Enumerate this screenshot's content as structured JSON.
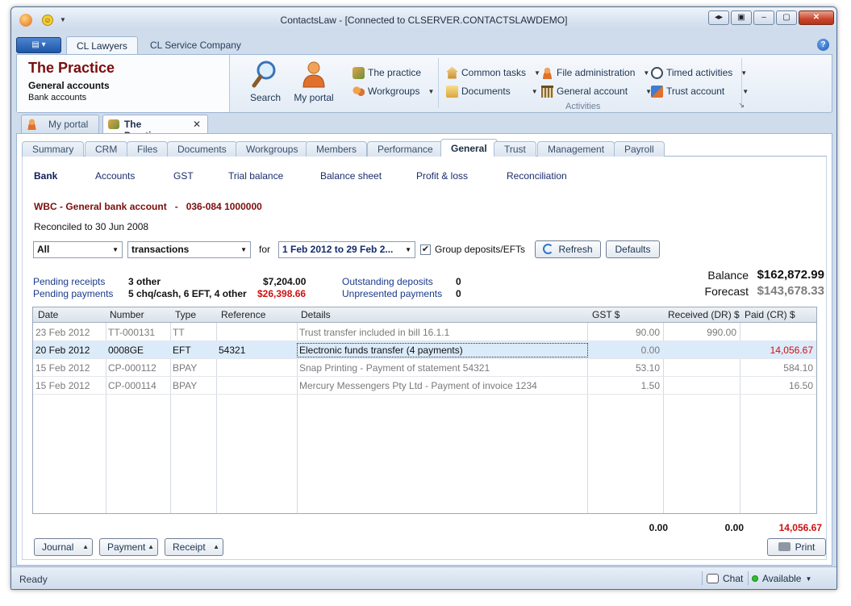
{
  "window": {
    "title": "ContactsLaw - [Connected to CLSERVER.CONTACTSLAWDEMO]"
  },
  "ribbon": {
    "tabs": [
      "CL Lawyers",
      "CL Service Company"
    ],
    "context": {
      "title": "The Practice",
      "subtitle": "General accounts",
      "subtitle2": "Bank accounts"
    },
    "buttons": {
      "search": "Search",
      "my_portal": "My portal",
      "the_practice": "The practice",
      "workgroups": "Workgroups",
      "common_tasks": "Common tasks",
      "documents": "Documents",
      "file_administration": "File administration",
      "general_account": "General account",
      "timed_activities": "Timed activities",
      "trust_account": "Trust account"
    },
    "group_label": "Activities"
  },
  "doc_tabs": [
    "My portal",
    "The Practice"
  ],
  "sub_tabs": [
    "Summary",
    "CRM",
    "Files",
    "Documents",
    "Workgroups",
    "Members",
    "Performance",
    "General",
    "Trust",
    "Management",
    "Payroll"
  ],
  "active_sub_tab": "General",
  "links": [
    "Bank",
    "Accounts",
    "GST",
    "Trial balance",
    "Balance sheet",
    "Profit & loss",
    "Reconciliation"
  ],
  "account": {
    "title": "WBC - General bank account   -   036-084 1000000",
    "reconciled": "Reconciled to 30 Jun 2008"
  },
  "filters": {
    "scope": "All",
    "kind": "transactions",
    "for_label": "for",
    "date_range": "1 Feb 2012 to 29 Feb 2...",
    "group_check_label": "Group deposits/EFTs",
    "group_checked": true,
    "refresh": "Refresh",
    "defaults": "Defaults"
  },
  "pending": {
    "receipts_label": "Pending receipts",
    "receipts_count": "3 other",
    "receipts_amount": "$7,204.00",
    "payments_label": "Pending payments",
    "payments_count": "5 chq/cash, 6 EFT, 4 other",
    "payments_amount": "$26,398.66",
    "outstanding_label": "Outstanding deposits",
    "outstanding_value": "0",
    "unpresented_label": "Unpresented payments",
    "unpresented_value": "0"
  },
  "balance": {
    "balance_label": "Balance",
    "balance_value": "$162,872.99",
    "forecast_label": "Forecast",
    "forecast_value": "$143,678.33"
  },
  "table": {
    "columns": [
      "Date",
      "Number",
      "Type",
      "Reference",
      "Details",
      "GST $",
      "Received (DR) $",
      "Paid (CR) $"
    ],
    "rows": [
      {
        "date": "23 Feb 2012",
        "number": "TT-000131",
        "type": "TT",
        "reference": "",
        "details": "Trust transfer included in bill 16.1.1",
        "gst": "90.00",
        "received": "990.00",
        "paid": ""
      },
      {
        "date": "20 Feb 2012",
        "number": "0008GE",
        "type": "EFT",
        "reference": "54321",
        "details": "Electronic funds transfer (4 payments)",
        "gst": "0.00",
        "received": "",
        "paid": "14,056.67"
      },
      {
        "date": "15 Feb 2012",
        "number": "CP-000112",
        "type": "BPAY",
        "reference": "",
        "details": "Snap Printing - Payment of statement 54321",
        "gst": "53.10",
        "received": "",
        "paid": "584.10"
      },
      {
        "date": "15 Feb 2012",
        "number": "CP-000114",
        "type": "BPAY",
        "reference": "",
        "details": "Mercury Messengers Pty Ltd - Payment of invoice 1234",
        "gst": "1.50",
        "received": "",
        "paid": "16.50"
      }
    ],
    "totals": {
      "gst": "0.00",
      "received": "0.00",
      "paid": "14,056.67"
    }
  },
  "bottom_buttons": {
    "journal": "Journal",
    "payment": "Payment",
    "receipt": "Receipt",
    "print": "Print"
  },
  "status": {
    "ready": "Ready",
    "chat": "Chat",
    "availability": "Available"
  },
  "colors": {
    "context_title": "#7b0d0d",
    "negative": "#cc1111",
    "link": "#1a2d6b",
    "selected_row": "#dcebfa"
  }
}
